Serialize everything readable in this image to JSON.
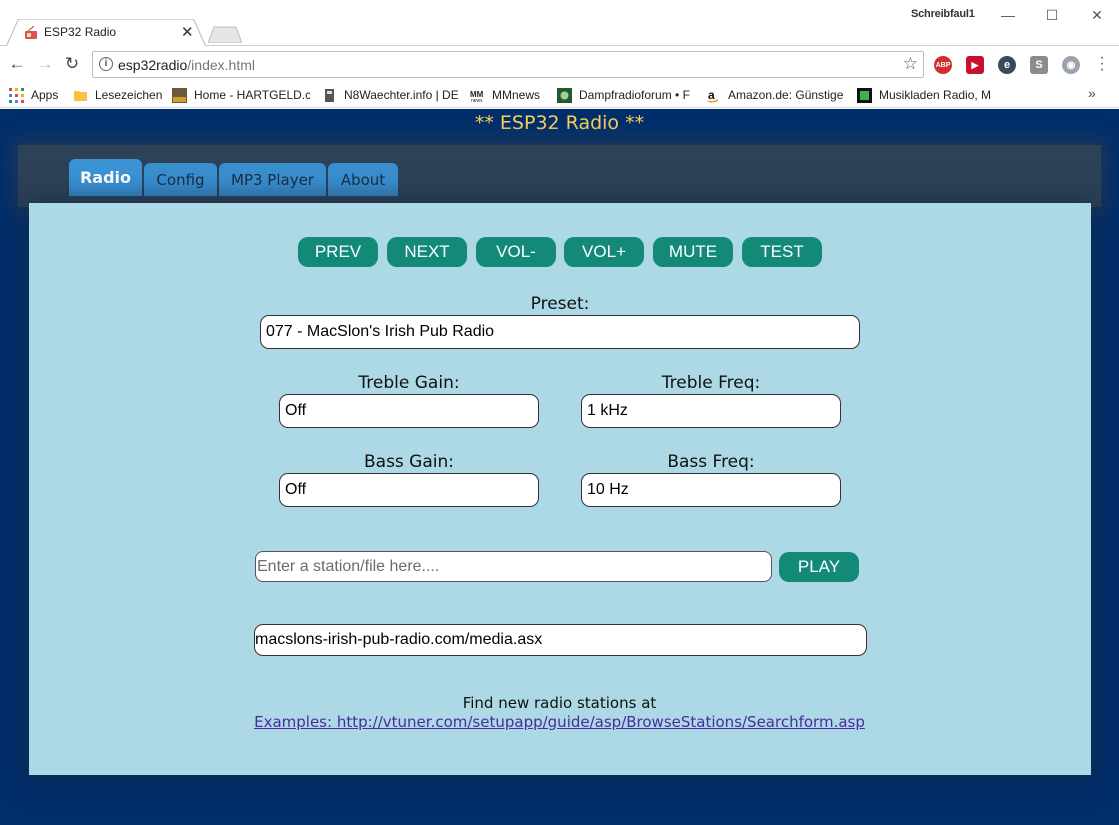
{
  "browser": {
    "tab_title": "ESP32 Radio",
    "tab_close": "✕",
    "profile_name": "Schreibfaul1",
    "window_buttons": {
      "minimize": "—",
      "maximize": "☐",
      "close": "✕"
    },
    "url_host": "esp32radio",
    "url_path": "/index.html",
    "extensions": [
      "ABP",
      "▶",
      "e",
      "S",
      "◉"
    ],
    "bookmarks": [
      {
        "label": "Apps",
        "icon": "apps-grid-icon"
      },
      {
        "label": "Lesezeichen",
        "icon": "folder-icon"
      },
      {
        "label": "Home - HARTGELD.co",
        "icon": "hartgeld-icon"
      },
      {
        "label": "N8Waechter.info | DE",
        "icon": "n8waechter-icon"
      },
      {
        "label": "MMnews",
        "icon": "mmnews-icon"
      },
      {
        "label": "Dampfradioforum • F",
        "icon": "dampfradio-icon"
      },
      {
        "label": "Amazon.de: Günstige",
        "icon": "amazon-icon"
      },
      {
        "label": "Musikladen Radio, M",
        "icon": "musikladen-icon"
      }
    ],
    "bookmarks_more": "»"
  },
  "page": {
    "title": "** ESP32 Radio **",
    "nav_tabs": [
      {
        "label": "Radio",
        "active": true
      },
      {
        "label": "Config",
        "active": false
      },
      {
        "label": "MP3 Player",
        "active": false
      },
      {
        "label": "About",
        "active": false
      }
    ],
    "controls": [
      "PREV",
      "NEXT",
      "VOL-",
      "VOL+",
      "MUTE",
      "TEST"
    ],
    "preset": {
      "label": "Preset:",
      "value": "077 - MacSlon's Irish Pub Radio"
    },
    "treble_gain": {
      "label": "Treble Gain:",
      "value": "Off"
    },
    "treble_freq": {
      "label": "Treble Freq:",
      "value": "1 kHz"
    },
    "bass_gain": {
      "label": "Bass Gain:",
      "value": "Off"
    },
    "bass_freq": {
      "label": "Bass Freq:",
      "value": "10 Hz"
    },
    "station_input": {
      "placeholder": "Enter a station/file here....",
      "value": ""
    },
    "play_label": "PLAY",
    "stream_url": "macslons-irish-pub-radio.com/media.asx",
    "find_text": "Find new radio stations at",
    "find_link": "Examples: http://vtuner.com/setupapp/guide/asp/BrowseStations/Searchform.asp"
  },
  "colors": {
    "page_bg": "#002f6c",
    "content_bg": "#add8e6",
    "button": "#128a77",
    "tab": "#3a8fcf",
    "title": "#ffd25a"
  }
}
